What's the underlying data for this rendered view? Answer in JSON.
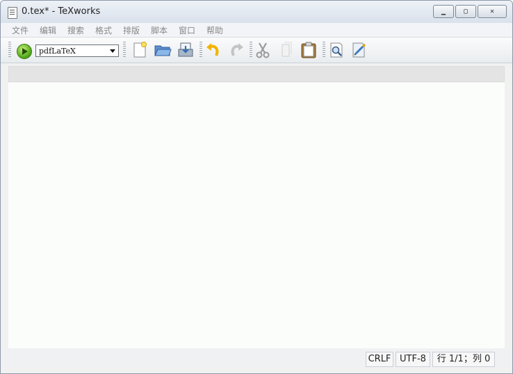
{
  "window": {
    "title": "0.tex* - TeXworks"
  },
  "menus": [
    "文件",
    "编辑",
    "搜索",
    "格式",
    "排版",
    "脚本",
    "窗口",
    "帮助"
  ],
  "toolbar": {
    "engine_selected": "pdfLaTeX",
    "icons": [
      "typeset-icon",
      "new-file-icon",
      "open-folder-icon",
      "save-icon",
      "undo-icon",
      "redo-icon",
      "cut-icon",
      "copy-icon",
      "paste-icon",
      "find-icon",
      "replace-icon"
    ]
  },
  "status": {
    "line_ending": "CRLF",
    "encoding": "UTF-8",
    "position": "行 1/1；列 0"
  },
  "colors": {
    "run_green": "#4aa114",
    "folder_blue": "#3f78c0",
    "paste_brown": "#a47a3e"
  }
}
